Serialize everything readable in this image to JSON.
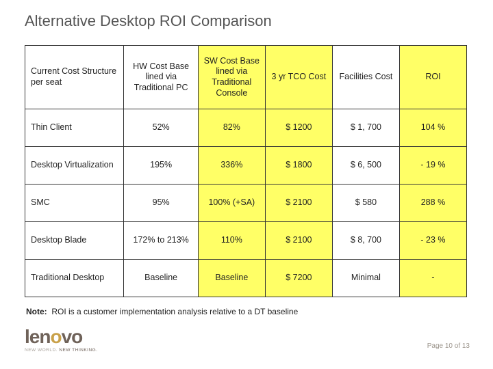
{
  "title": "Alternative Desktop ROI Comparison",
  "headers": {
    "c0": "Current Cost Structure per seat",
    "c1": "HW Cost Base lined via Traditional PC",
    "c2": "SW Cost Base lined via Traditional Console",
    "c3": "3 yr TCO Cost",
    "c4": "Facilities Cost",
    "c5": "ROI"
  },
  "rows": [
    {
      "name": "Thin Client",
      "hw": "52%",
      "sw": "82%",
      "tco": "$   1200",
      "fac": "$  1, 700",
      "roi": "104 %"
    },
    {
      "name": "Desktop Virtualization",
      "hw": "195%",
      "sw": "336%",
      "tco": "$   1800",
      "fac": "$  6, 500",
      "roi": "- 19 %"
    },
    {
      "name": "SMC",
      "hw": "95%",
      "sw": "100% (+SA)",
      "tco": "$   2100",
      "fac": "$      580",
      "roi": "288 %"
    },
    {
      "name": "Desktop Blade",
      "hw": "172% to 213%",
      "sw": "110%",
      "tco": "$   2100",
      "fac": "$  8, 700",
      "roi": "- 23 %"
    },
    {
      "name": "Traditional Desktop",
      "hw": "Baseline",
      "sw": "Baseline",
      "tco": "$ 7200",
      "fac": "Minimal",
      "roi": "-"
    }
  ],
  "note_label": "Note:",
  "note_text": "ROI is a customer implementation analysis relative to a DT baseline",
  "logo_text_pre": "len",
  "logo_text_accent": "o",
  "logo_text_post": "vo",
  "tagline_a": "NEW WORLD.",
  "tagline_b": "NEW THINKING.",
  "page_label": "Page 10 of 13",
  "chart_data": {
    "type": "table",
    "title": "Alternative Desktop ROI Comparison",
    "columns": [
      "Current Cost Structure per seat",
      "HW Cost Base lined via Traditional PC",
      "SW Cost Base lined via Traditional Console",
      "3 yr TCO Cost",
      "Facilities Cost",
      "ROI"
    ],
    "highlight_columns": [
      "SW Cost Base lined via Traditional Console",
      "3 yr TCO Cost",
      "ROI"
    ],
    "rows": [
      [
        "Thin Client",
        "52%",
        "82%",
        "$ 1200",
        "$ 1,700",
        "104 %"
      ],
      [
        "Desktop Virtualization",
        "195%",
        "336%",
        "$ 1800",
        "$ 6,500",
        "- 19 %"
      ],
      [
        "SMC",
        "95%",
        "100% (+SA)",
        "$ 2100",
        "$ 580",
        "288 %"
      ],
      [
        "Desktop Blade",
        "172% to 213%",
        "110%",
        "$ 2100",
        "$ 8,700",
        "- 23 %"
      ],
      [
        "Traditional Desktop",
        "Baseline",
        "Baseline",
        "$ 7200",
        "Minimal",
        "-"
      ]
    ]
  }
}
